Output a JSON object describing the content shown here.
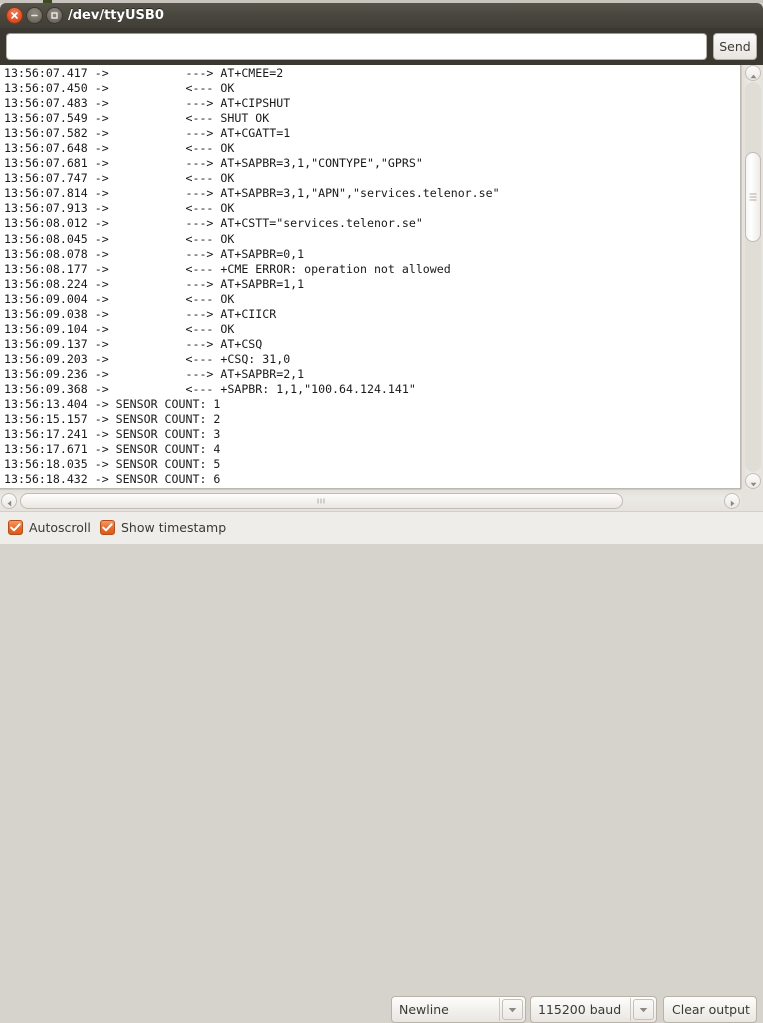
{
  "window": {
    "title": "/dev/ttyUSB0",
    "controls": {
      "close": "close-button",
      "minimize": "minimize-button",
      "maximize": "maximize-button"
    }
  },
  "send_row": {
    "input_value": "",
    "input_placeholder": "",
    "send_label": "Send"
  },
  "console": {
    "lines": [
      "13:56:07.417 ->           ---> AT+CMEE=2",
      "13:56:07.450 ->           <--- OK",
      "13:56:07.483 ->           ---> AT+CIPSHUT",
      "13:56:07.549 ->           <--- SHUT OK",
      "13:56:07.582 ->           ---> AT+CGATT=1",
      "13:56:07.648 ->           <--- OK",
      "13:56:07.681 ->           ---> AT+SAPBR=3,1,\"CONTYPE\",\"GPRS\"",
      "13:56:07.747 ->           <--- OK",
      "13:56:07.814 ->           ---> AT+SAPBR=3,1,\"APN\",\"services.telenor.se\"",
      "13:56:07.913 ->           <--- OK",
      "13:56:08.012 ->           ---> AT+CSTT=\"services.telenor.se\"",
      "13:56:08.045 ->           <--- OK",
      "13:56:08.078 ->           ---> AT+SAPBR=0,1",
      "13:56:08.177 ->           <--- +CME ERROR: operation not allowed",
      "13:56:08.224 ->           ---> AT+SAPBR=1,1",
      "13:56:09.004 ->           <--- OK",
      "13:56:09.038 ->           ---> AT+CIICR",
      "13:56:09.104 ->           <--- OK",
      "13:56:09.137 ->           ---> AT+CSQ",
      "13:56:09.203 ->           <--- +CSQ: 31,0",
      "13:56:09.236 ->           ---> AT+SAPBR=2,1",
      "13:56:09.368 ->           <--- +SAPBR: 1,1,\"100.64.124.141\"",
      "13:56:13.404 -> SENSOR COUNT: 1",
      "13:56:15.157 -> SENSOR COUNT: 2",
      "13:56:17.241 -> SENSOR COUNT: 3",
      "13:56:17.671 -> SENSOR COUNT: 4",
      "13:56:18.035 -> SENSOR COUNT: 5",
      "13:56:18.432 -> SENSOR COUNT: 6"
    ]
  },
  "statusbar": {
    "autoscroll_label": "Autoscroll",
    "autoscroll_checked": true,
    "timestamp_label": "Show timestamp",
    "timestamp_checked": true,
    "line_ending": "Newline",
    "baud_rate": "115200 baud",
    "clear_label": "Clear output"
  },
  "colors": {
    "titlebar": "#4a473f",
    "close_accent": "#e2552a",
    "checkbox_accent": "#e8682a",
    "console_bg": "#ffffff",
    "console_text": "#1a1a1a",
    "statusbar_bg": "#efedea"
  }
}
